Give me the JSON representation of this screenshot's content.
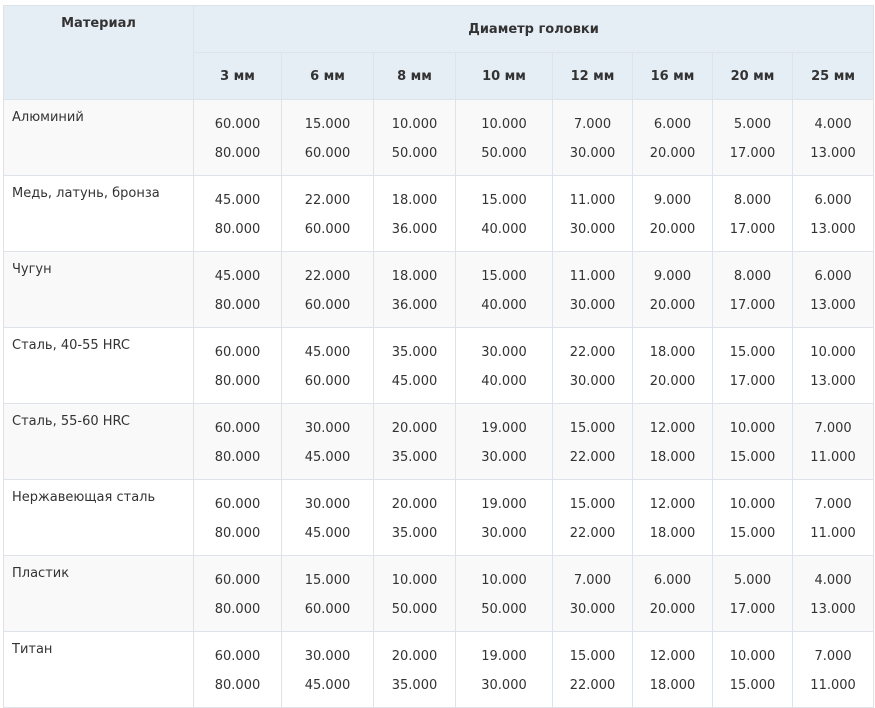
{
  "table": {
    "material_header": "Материал",
    "group_header": "Диаметр головки",
    "sizes": [
      "3 мм",
      "6 мм",
      "8 мм",
      "10 мм",
      "12 мм",
      "16 мм",
      "20 мм",
      "25 мм"
    ],
    "rows": [
      {
        "material": "Алюминий",
        "values": [
          [
            "60.000",
            "80.000"
          ],
          [
            "15.000",
            "60.000"
          ],
          [
            "10.000",
            "50.000"
          ],
          [
            "10.000",
            "50.000"
          ],
          [
            "7.000",
            "30.000"
          ],
          [
            "6.000",
            "20.000"
          ],
          [
            "5.000",
            "17.000"
          ],
          [
            "4.000",
            "13.000"
          ]
        ]
      },
      {
        "material": "Медь, латунь, бронза",
        "values": [
          [
            "45.000",
            "80.000"
          ],
          [
            "22.000",
            "60.000"
          ],
          [
            "18.000",
            "36.000"
          ],
          [
            "15.000",
            "40.000"
          ],
          [
            "11.000",
            "30.000"
          ],
          [
            "9.000",
            "20.000"
          ],
          [
            "8.000",
            "17.000"
          ],
          [
            "6.000",
            "13.000"
          ]
        ]
      },
      {
        "material": "Чугун",
        "values": [
          [
            "45.000",
            "80.000"
          ],
          [
            "22.000",
            "60.000"
          ],
          [
            "18.000",
            "36.000"
          ],
          [
            "15.000",
            "40.000"
          ],
          [
            "11.000",
            "30.000"
          ],
          [
            "9.000",
            "20.000"
          ],
          [
            "8.000",
            "17.000"
          ],
          [
            "6.000",
            "13.000"
          ]
        ]
      },
      {
        "material": "Сталь, 40-55 HRC",
        "values": [
          [
            "60.000",
            "80.000"
          ],
          [
            "45.000",
            "60.000"
          ],
          [
            "35.000",
            "45.000"
          ],
          [
            "30.000",
            "40.000"
          ],
          [
            "22.000",
            "30.000"
          ],
          [
            "18.000",
            "20.000"
          ],
          [
            "15.000",
            "17.000"
          ],
          [
            "10.000",
            "13.000"
          ]
        ]
      },
      {
        "material": "Сталь, 55-60 HRC",
        "values": [
          [
            "60.000",
            "80.000"
          ],
          [
            "30.000",
            "45.000"
          ],
          [
            "20.000",
            "35.000"
          ],
          [
            "19.000",
            "30.000"
          ],
          [
            "15.000",
            "22.000"
          ],
          [
            "12.000",
            "18.000"
          ],
          [
            "10.000",
            "15.000"
          ],
          [
            "7.000",
            "11.000"
          ]
        ]
      },
      {
        "material": "Нержавеющая сталь",
        "values": [
          [
            "60.000",
            "80.000"
          ],
          [
            "30.000",
            "45.000"
          ],
          [
            "20.000",
            "35.000"
          ],
          [
            "19.000",
            "30.000"
          ],
          [
            "15.000",
            "22.000"
          ],
          [
            "12.000",
            "18.000"
          ],
          [
            "10.000",
            "15.000"
          ],
          [
            "7.000",
            "11.000"
          ]
        ]
      },
      {
        "material": "Пластик",
        "values": [
          [
            "60.000",
            "80.000"
          ],
          [
            "15.000",
            "60.000"
          ],
          [
            "10.000",
            "50.000"
          ],
          [
            "10.000",
            "50.000"
          ],
          [
            "7.000",
            "30.000"
          ],
          [
            "6.000",
            "20.000"
          ],
          [
            "5.000",
            "17.000"
          ],
          [
            "4.000",
            "13.000"
          ]
        ]
      },
      {
        "material": "Титан",
        "values": [
          [
            "60.000",
            "80.000"
          ],
          [
            "30.000",
            "45.000"
          ],
          [
            "20.000",
            "35.000"
          ],
          [
            "19.000",
            "30.000"
          ],
          [
            "15.000",
            "22.000"
          ],
          [
            "12.000",
            "18.000"
          ],
          [
            "10.000",
            "15.000"
          ],
          [
            "7.000",
            "11.000"
          ]
        ]
      }
    ]
  }
}
